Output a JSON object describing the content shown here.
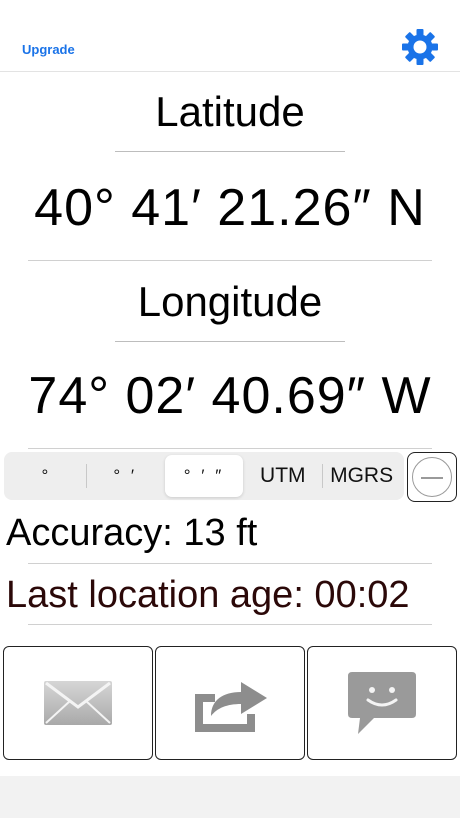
{
  "header": {
    "upgrade_label": "Upgrade",
    "settings_icon": "gear-icon",
    "accent_color": "#1a73e8"
  },
  "latitude": {
    "label": "Latitude",
    "value": "40° 41′ 21.26″ N"
  },
  "longitude": {
    "label": "Longitude",
    "value": "74° 02′ 40.69″ W"
  },
  "format_selector": {
    "options": [
      "°",
      "° ′",
      "° ′ ″",
      "UTM",
      "MGRS"
    ],
    "selected": "° ′ ″",
    "toggle_icon": "minus-circle-icon"
  },
  "status": {
    "accuracy": "Accuracy: 13 ft",
    "last_location_age": "Last location age: 00:02"
  },
  "actions": [
    {
      "icon": "mail-icon"
    },
    {
      "icon": "share-icon"
    },
    {
      "icon": "message-icon"
    }
  ]
}
